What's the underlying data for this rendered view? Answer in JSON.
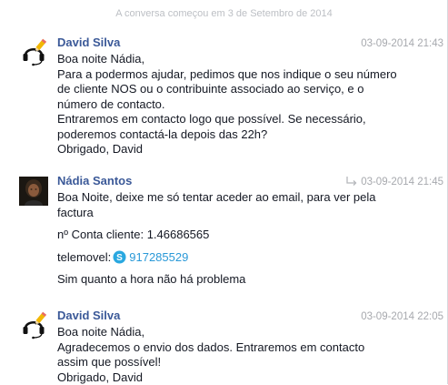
{
  "conversation": {
    "started_label": "A conversa começou em 3 de Setembro de 2014"
  },
  "messages": [
    {
      "sender": "David Silva",
      "timestamp": "03-09-2014 21:43",
      "avatar_icon": "headset-pencil-icon",
      "lines": [
        "Boa noite Nádia,",
        "Para a podermos ajudar, pedimos que nos indique o seu número",
        "de cliente NOS ou o contribuinte associado ao serviço, e o",
        "número de contacto.",
        "Entraremos em contacto logo que possível. Se necessário,",
        "poderemos contactá-la depois das 22h?",
        "Obrigado, David"
      ]
    },
    {
      "sender": "Nádia Santos",
      "timestamp": "03-09-2014 21:45",
      "reply_icon": "reply-arrow-icon",
      "avatar_icon": "user-photo",
      "paragraphs": [
        "Boa Noite, deixe me só tentar aceder ao email, para ver pela",
        "factura",
        "nº Conta cliente: 1.46686565",
        "telemovel:",
        "Sim quanto a hora não há problema"
      ],
      "phone_link": "917285529",
      "phone_icon": "skype-icon"
    },
    {
      "sender": "David Silva",
      "timestamp": "03-09-2014 22:05",
      "avatar_icon": "headset-pencil-icon",
      "lines": [
        "Boa noite Nádia,",
        "Agradecemos o envio dos dados. Entraremos em contacto",
        "assim que possível!",
        "Obrigado, David"
      ]
    }
  ],
  "colors": {
    "name": "#3b5998",
    "timestamp": "#a7a9ae",
    "link": "#2a99d8",
    "text": "#141823"
  }
}
